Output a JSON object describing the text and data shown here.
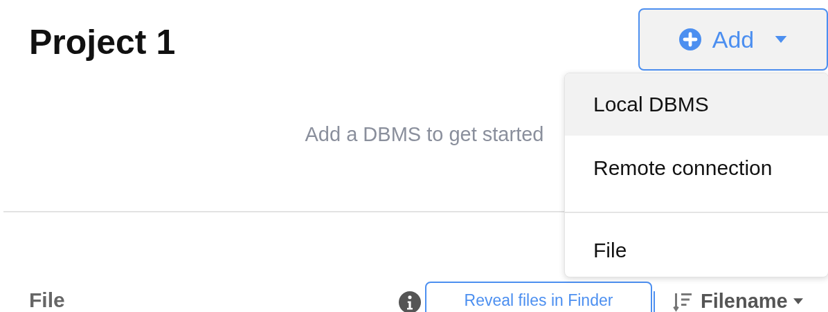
{
  "header": {
    "title": "Project 1",
    "add_button": {
      "label": "Add",
      "expanded": true
    }
  },
  "empty_state": "Add a DBMS to get started",
  "add_menu": {
    "sections": [
      [
        {
          "label": "Local DBMS",
          "selected": true
        },
        {
          "label": "Remote connection",
          "selected": false
        }
      ],
      [
        {
          "label": "File",
          "selected": false
        }
      ]
    ]
  },
  "files": {
    "heading": "File",
    "reveal_button": "Reveal files in Finder",
    "sort": {
      "label": "Filename"
    }
  }
}
